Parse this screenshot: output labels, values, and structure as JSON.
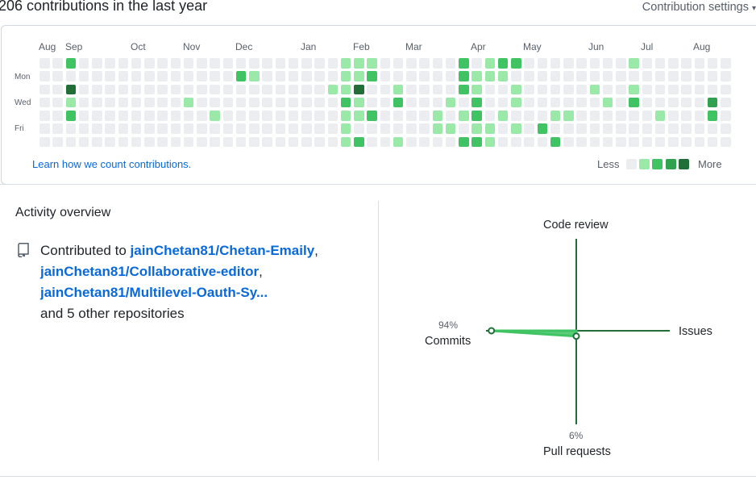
{
  "header": {
    "title": "206 contributions in the last year",
    "settings_label": "Contribution settings",
    "settings_caret": "▾"
  },
  "calendar": {
    "months": [
      "Aug",
      "Sep",
      "Oct",
      "Nov",
      "Dec",
      "Jan",
      "Feb",
      "Mar",
      "Apr",
      "May",
      "Jun",
      "Jul",
      "Aug"
    ],
    "days": [
      "Mon",
      "Wed",
      "Fri"
    ],
    "colors": [
      "#ebedf0",
      "#9be9a8",
      "#40c463",
      "#30a14e",
      "#216e39"
    ],
    "weeks": [
      [
        0,
        0,
        0,
        0,
        0,
        0,
        0
      ],
      [
        0,
        0,
        0,
        0,
        0,
        0,
        0
      ],
      [
        2,
        0,
        4,
        1,
        2,
        0,
        0
      ],
      [
        0,
        0,
        0,
        0,
        0,
        0,
        0
      ],
      [
        0,
        0,
        0,
        0,
        0,
        0,
        0
      ],
      [
        0,
        0,
        0,
        0,
        0,
        0,
        0
      ],
      [
        0,
        0,
        0,
        0,
        0,
        0,
        0
      ],
      [
        0,
        0,
        0,
        0,
        0,
        0,
        0
      ],
      [
        0,
        0,
        0,
        0,
        0,
        0,
        0
      ],
      [
        0,
        0,
        0,
        0,
        0,
        0,
        0
      ],
      [
        0,
        0,
        0,
        0,
        0,
        0,
        0
      ],
      [
        0,
        0,
        0,
        1,
        0,
        0,
        0
      ],
      [
        0,
        0,
        0,
        0,
        0,
        0,
        0
      ],
      [
        0,
        0,
        0,
        0,
        1,
        0,
        0
      ],
      [
        0,
        0,
        0,
        0,
        0,
        0,
        0
      ],
      [
        0,
        2,
        0,
        0,
        0,
        0,
        0
      ],
      [
        0,
        1,
        0,
        0,
        0,
        0,
        0
      ],
      [
        0,
        0,
        0,
        0,
        0,
        0,
        0
      ],
      [
        0,
        0,
        0,
        0,
        0,
        0,
        0
      ],
      [
        0,
        0,
        0,
        0,
        0,
        0,
        0
      ],
      [
        0,
        0,
        0,
        0,
        0,
        0,
        0
      ],
      [
        0,
        0,
        0,
        0,
        0,
        0,
        0
      ],
      [
        0,
        0,
        1,
        0,
        0,
        0,
        0
      ],
      [
        1,
        1,
        1,
        2,
        1,
        1,
        1
      ],
      [
        1,
        1,
        4,
        1,
        1,
        0,
        2
      ],
      [
        1,
        2,
        0,
        0,
        2,
        0,
        0
      ],
      [
        0,
        0,
        0,
        0,
        0,
        0,
        0
      ],
      [
        0,
        0,
        1,
        2,
        0,
        0,
        1
      ],
      [
        0,
        0,
        0,
        0,
        0,
        0,
        0
      ],
      [
        0,
        0,
        0,
        0,
        0,
        0,
        0
      ],
      [
        0,
        0,
        0,
        0,
        1,
        1,
        0
      ],
      [
        0,
        0,
        0,
        1,
        0,
        1,
        0
      ],
      [
        2,
        2,
        2,
        0,
        1,
        0,
        2
      ],
      [
        0,
        1,
        1,
        2,
        2,
        1,
        2
      ],
      [
        1,
        1,
        0,
        0,
        0,
        1,
        1
      ],
      [
        2,
        1,
        0,
        0,
        1,
        0,
        0
      ],
      [
        2,
        0,
        1,
        1,
        0,
        1,
        0
      ],
      [
        0,
        0,
        0,
        0,
        0,
        0,
        0
      ],
      [
        0,
        0,
        0,
        0,
        0,
        2,
        0
      ],
      [
        0,
        0,
        0,
        0,
        1,
        0,
        2
      ],
      [
        0,
        0,
        0,
        0,
        1,
        0,
        0
      ],
      [
        0,
        0,
        0,
        0,
        0,
        0,
        0
      ],
      [
        0,
        0,
        1,
        0,
        0,
        0,
        0
      ],
      [
        0,
        0,
        0,
        1,
        0,
        0,
        0
      ],
      [
        0,
        0,
        0,
        0,
        0,
        0,
        0
      ],
      [
        1,
        0,
        1,
        2,
        0,
        0,
        0
      ],
      [
        0,
        0,
        0,
        0,
        0,
        0,
        0
      ],
      [
        0,
        0,
        0,
        0,
        1,
        0,
        0
      ],
      [
        0,
        0,
        0,
        0,
        0,
        0,
        0
      ],
      [
        0,
        0,
        0,
        0,
        0,
        0,
        0
      ],
      [
        0,
        0,
        0,
        0,
        0,
        0,
        0
      ],
      [
        0,
        0,
        0,
        3,
        2,
        0,
        0
      ],
      [
        0,
        0,
        0,
        0,
        0,
        0,
        0
      ]
    ],
    "learn_link": "Learn how we count contributions.",
    "legend_less": "Less",
    "legend_more": "More"
  },
  "activity": {
    "title": "Activity overview",
    "contributed_prefix": "Contributed to",
    "repos": [
      "jainChetan81/Chetan-Emaily",
      "jainChetan81/Collaborative-editor",
      "jainChetan81/Multilevel-Oauth-Sy..."
    ],
    "others": "and 5 other repositories",
    "icon": "repo-icon"
  },
  "radar": {
    "code_review": "Code review",
    "issues": "Issues",
    "pull_requests": "Pull requests",
    "commits": "Commits",
    "commits_pct": "94%",
    "pull_requests_pct": "6%",
    "commits_value": 94,
    "pull_requests_value": 6,
    "issues_value": 0,
    "code_review_value": 0,
    "axis_color": "#216e39",
    "fill_color": "#40c463"
  }
}
